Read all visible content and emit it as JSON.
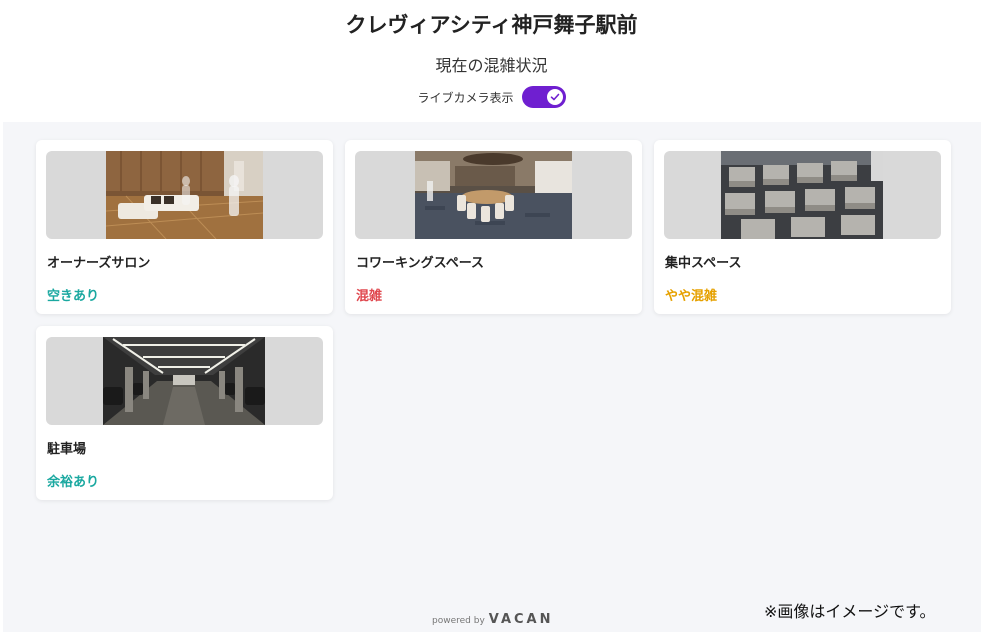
{
  "header": {
    "title": "クレヴィアシティ神戸舞子駅前",
    "subtitle": "現在の混雑状況",
    "toggle_label": "ライブカメラ表示",
    "toggle_on": true
  },
  "cards": [
    {
      "name": "オーナーズサロン",
      "status": "空きあり",
      "status_color": "#1aa8a0",
      "image": "owners-salon-photo"
    },
    {
      "name": "コワーキングスペース",
      "status": "混雑",
      "status_color": "#e0484f",
      "image": "coworking-space-photo"
    },
    {
      "name": "集中スペース",
      "status": "やや混雑",
      "status_color": "#e6a100",
      "image": "focus-space-photo"
    },
    {
      "name": "駐車場",
      "status": "余裕あり",
      "status_color": "#1aa8a0",
      "image": "parking-lot-photo"
    }
  ],
  "footer": {
    "powered_by": "powered by",
    "brand": "VACAN",
    "note": "※画像はイメージです。"
  },
  "colors": {
    "accent": "#6f1fd0",
    "background": "#f5f6f9",
    "status_available": "#1aa8a0",
    "status_crowded": "#e0484f",
    "status_somewhat": "#e6a100"
  }
}
